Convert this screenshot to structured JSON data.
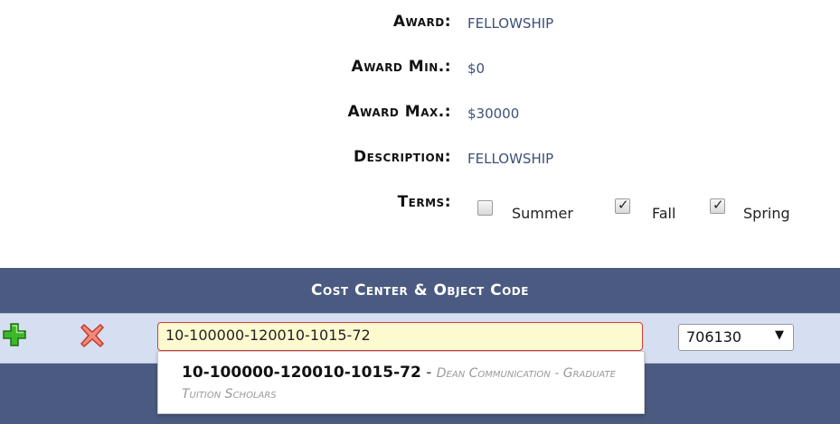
{
  "award": {
    "award_label": "Award:",
    "award_value": "FELLOWSHIP",
    "min_label": "Award Min.:",
    "min_value": "$0",
    "max_label": "Award Max.:",
    "max_value": "$30000",
    "desc_label": "Description:",
    "desc_value": "FELLOWSHIP",
    "terms_label": "Terms:",
    "terms": [
      {
        "label": "Summer",
        "checked": false
      },
      {
        "label": "Fall",
        "checked": true
      },
      {
        "label": "Spring",
        "checked": true
      }
    ]
  },
  "cost_center": {
    "header": "Cost Center & Object Code",
    "add_icon": "plus-icon",
    "delete_icon": "x-icon",
    "input_value": "10-100000-120010-1015-72",
    "object_code": "706130",
    "object_code_arrow": "▼",
    "suggestion": {
      "code": "10-100000-120010-1015-72",
      "separator": " - ",
      "description": "Dean Communication - Graduate Tuition Scholars"
    }
  },
  "colors": {
    "band": "#4a5a80",
    "row": "#d6def1",
    "value_text": "#3d4f7a",
    "input_bg": "#fdfad0",
    "input_border": "#d63a3a"
  }
}
